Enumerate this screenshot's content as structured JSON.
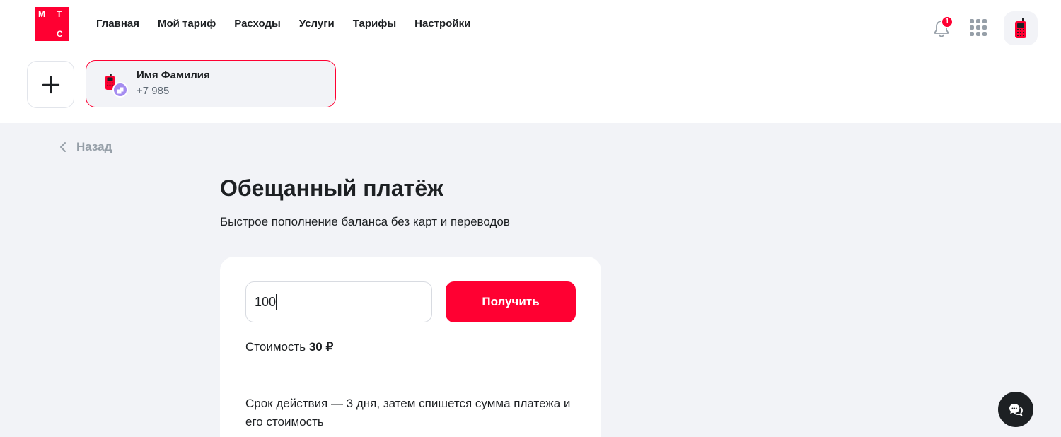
{
  "brand": {
    "logo_letters": [
      "М",
      "Т",
      "С"
    ],
    "color": "#ff0032"
  },
  "nav": {
    "items": [
      "Главная",
      "Мой тариф",
      "Расходы",
      "Услуги",
      "Тарифы",
      "Настройки"
    ]
  },
  "header": {
    "notifications_count": "1",
    "icons": [
      "bell-icon",
      "apps-grid-icon",
      "phone-icon"
    ]
  },
  "account": {
    "add_icon": "plus-icon",
    "name": "Имя Фамилия",
    "phone": "+7 985"
  },
  "back": {
    "label": "Назад"
  },
  "page": {
    "title": "Обещанный платёж",
    "subtitle": "Быстрое пополнение баланса без карт и переводов"
  },
  "form": {
    "amount_value": "100",
    "submit_label": "Получить",
    "cost_label": "Стоимость",
    "cost_value": "30 ₽",
    "term_text": "Срок действия — 3 дня, затем спишется сумма платежа и его стоимость"
  },
  "chat": {
    "icon": "chat-icon"
  },
  "colors": {
    "accent": "#ff0032",
    "background": "#f2f3f7",
    "text": "#1d2023",
    "muted": "#969fa8"
  }
}
